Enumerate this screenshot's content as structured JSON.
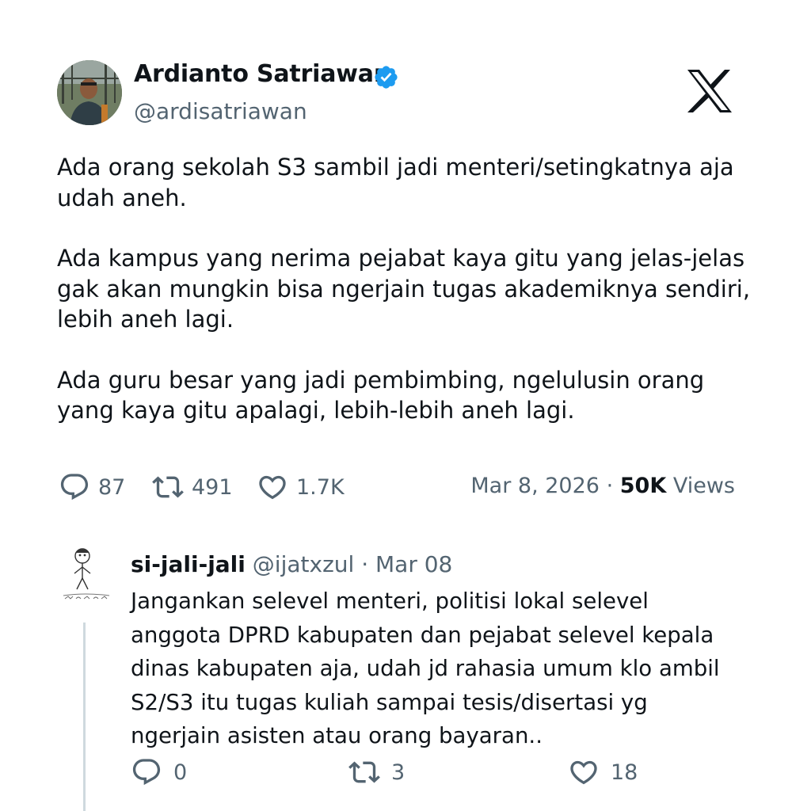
{
  "tweet": {
    "author": {
      "display_name": "Ardianto Satriawan",
      "handle": "@ardisatriawan",
      "verified": true,
      "avatar": "profile-photo"
    },
    "brand_icon": "x-logo-icon",
    "paragraphs": [
      "Ada orang sekolah S3 sambil jadi menteri/setingkatnya aja\nudah aneh.",
      "Ada kampus yang nerima pejabat kaya gitu yang jelas-jelas\ngak akan mungkin bisa ngerjain tugas akademiknya sendiri,\nlebih aneh lagi.",
      "Ada guru besar yang jadi pembimbing, ngelulusin orang\nyang kaya gitu apalagi, lebih-lebih aneh lagi."
    ],
    "stats": {
      "replies": "87",
      "reposts": "491",
      "likes": "1.7K"
    },
    "date": "Mar 8, 2026",
    "separator": "·",
    "views_count": "50K",
    "views_label": "Views"
  },
  "reply": {
    "display_name": "si-jali-jali",
    "handle": "@ijatxzul",
    "separator": "·",
    "date": "Mar 08",
    "text": "Jangankan selevel menteri, politisi lokal selevel\nanggota DPRD kabupaten dan pejabat selevel kepala\ndinas kabupaten aja, udah jd rahasia umum klo ambil\nS2/S3 itu tugas kuliah sampai tesis/disertasi yg\nngerjain asisten atau orang bayaran..",
    "stats": {
      "replies": "0",
      "reposts": "3",
      "likes": "18"
    }
  },
  "colors": {
    "text": "#0f1419",
    "secondary": "#536471",
    "verified": "#1d9bf0",
    "thread_line": "#cfd9de"
  }
}
